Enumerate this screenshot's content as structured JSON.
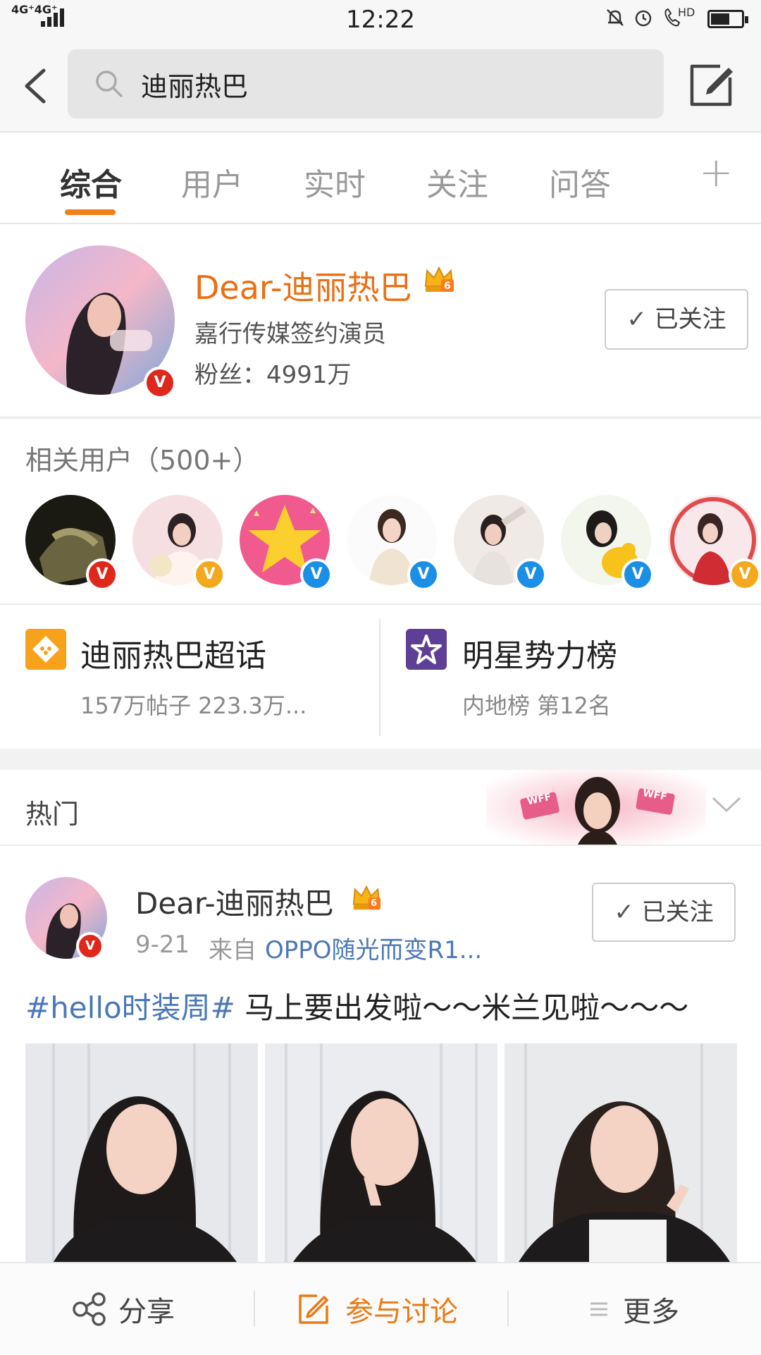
{
  "status_bar": {
    "network": "4G⁺4G⁺",
    "time": "12:22",
    "hd": "HD"
  },
  "search": {
    "query": "迪丽热巴"
  },
  "tabs": [
    {
      "label": "综合",
      "active": true
    },
    {
      "label": "用户",
      "active": false
    },
    {
      "label": "实时",
      "active": false
    },
    {
      "label": "关注",
      "active": false
    },
    {
      "label": "问答",
      "active": false
    }
  ],
  "tab_plus": "+",
  "profile": {
    "name": "Dear-迪丽热巴",
    "crown_level": "6",
    "description": "嘉行传媒签约演员",
    "fans": "粉丝：4991万",
    "follow_label": "已关注",
    "badge": "V"
  },
  "related_users": {
    "title": "相关用户（500+）",
    "badges": [
      "V",
      "V",
      "V",
      "V",
      "V",
      "V",
      "V"
    ]
  },
  "topics": {
    "supertopic": {
      "title": "迪丽热巴超话",
      "subtitle": "157万帖子  223.3万..."
    },
    "ranking": {
      "title": "明星势力榜",
      "subtitle": "内地榜 第12名"
    }
  },
  "hot": {
    "title": "热门",
    "banner_text": "WFF"
  },
  "post": {
    "author": "Dear-迪丽热巴",
    "crown_level": "6",
    "time": "9-21",
    "source_label": "来自",
    "source": "OPPO随光而变R1...",
    "follow_label": "已关注",
    "hashtag": "#hello时装周#",
    "text": " 马上要出发啦～～米兰见啦～～～"
  },
  "bottom_bar": {
    "share": "分享",
    "discuss": "参与讨论",
    "more": "更多"
  },
  "colors": {
    "accent_orange": "#f08019",
    "name_orange": "#eb6f14",
    "link_blue": "#4a78b8",
    "verified_red": "#e0271b",
    "verified_blue": "#1b8fe6",
    "verified_gold": "#f4a81d",
    "supertopic_orange": "#f8a21c",
    "ranking_purple": "#5f3f95"
  }
}
